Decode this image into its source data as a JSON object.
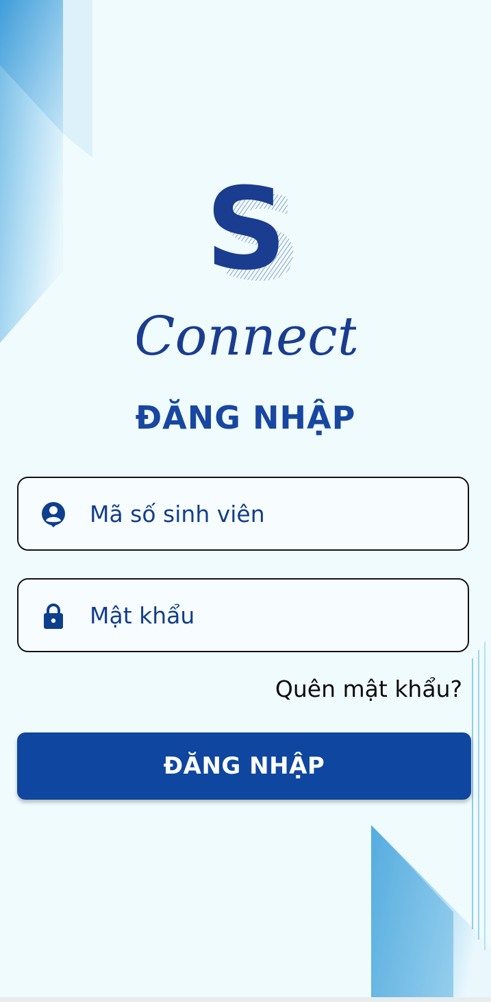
{
  "app": {
    "logo_text": "Connect",
    "logo_letter": "S"
  },
  "login": {
    "title": "ĐĂNG NHẬP",
    "student_id_placeholder": "Mã số sinh viên",
    "password_placeholder": "Mật khẩu",
    "forgot_password": "Quên mật khẩu?",
    "submit_label": "ĐĂNG NHẬP"
  },
  "icons": {
    "student_id": "user-icon",
    "password": "lock-icon"
  },
  "colors": {
    "background": "#f0fbfd",
    "primary": "#0e46a0",
    "title": "#1747a0",
    "logo": "#1a3d8f"
  }
}
